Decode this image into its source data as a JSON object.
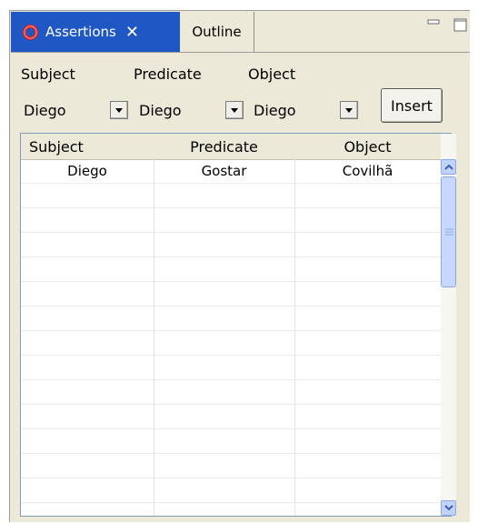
{
  "tabs": {
    "assertions_label": "Assertions",
    "outline_label": "Outline",
    "close_glyph": "✕",
    "assertions_icon": "assertions-ring-icon",
    "active_color": "#1f57c5"
  },
  "view_controls": {
    "minimize_icon": "minimize-icon",
    "maximize_icon": "maximize-icon"
  },
  "form": {
    "subject_label": "Subject",
    "predicate_label": "Predicate",
    "object_label": "Object",
    "subject_value": "Diego",
    "predicate_value": "Diego",
    "object_value": "Diego",
    "insert_label": "Insert"
  },
  "table": {
    "columns": [
      "Subject",
      "Predicate",
      "Object"
    ],
    "rows": [
      [
        "Diego",
        "Gostar",
        "Covilhã"
      ]
    ]
  }
}
